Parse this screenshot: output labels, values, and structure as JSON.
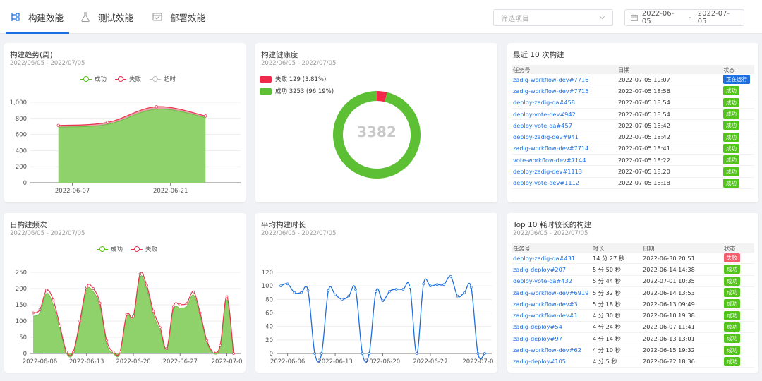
{
  "header": {
    "tabs": [
      {
        "label": "构建效能",
        "icon": "pipeline-icon",
        "active": true
      },
      {
        "label": "测试效能",
        "icon": "flask-icon",
        "active": false
      },
      {
        "label": "部署效能",
        "icon": "deploy-icon",
        "active": false
      }
    ],
    "project_select": {
      "placeholder": "筛选项目"
    },
    "date_range": {
      "start": "2022-06-05",
      "separator": "-",
      "end": "2022-07-05"
    }
  },
  "colors": {
    "accent": "#1b6fe0",
    "success": "#52c41a",
    "success_fill": "#8fd16a",
    "fail": "#e8344e",
    "timeout": "#c0c0c0",
    "running": "#1b6fe0"
  },
  "trend_card": {
    "title": "构建趋势(周)",
    "subtitle": "2022/06/05 - 2022/07/05",
    "legend": [
      {
        "name": "成功",
        "color": "#52c41a"
      },
      {
        "name": "失败",
        "color": "#e8344e"
      },
      {
        "name": "超时",
        "color": "#c0c0c0"
      }
    ]
  },
  "health_card": {
    "title": "构建健康度",
    "subtitle": "2022/06/05 - 2022/07/05",
    "legend": [
      {
        "label": "失败 129 (3.81%)",
        "color": "#f0284a"
      },
      {
        "label": "成功 3253 (96.19%)",
        "color": "#5cbf34"
      }
    ],
    "total": "3382"
  },
  "recent_card": {
    "title": "最近 10 次构建",
    "columns": [
      "任务号",
      "日期",
      "状态"
    ],
    "rows": [
      {
        "task": "zadig-workflow-dev#7716",
        "date": "2022-07-05 19:07",
        "status": "正在运行",
        "status_color": "#1b6fe0"
      },
      {
        "task": "zadig-workflow-dev#7715",
        "date": "2022-07-05 18:56",
        "status": "成功",
        "status_color": "#52c41a"
      },
      {
        "task": "deploy-zadig-qa#458",
        "date": "2022-07-05 18:54",
        "status": "成功",
        "status_color": "#52c41a"
      },
      {
        "task": "deploy-vote-dev#942",
        "date": "2022-07-05 18:54",
        "status": "成功",
        "status_color": "#52c41a"
      },
      {
        "task": "deploy-vote-qa#457",
        "date": "2022-07-05 18:42",
        "status": "成功",
        "status_color": "#52c41a"
      },
      {
        "task": "deploy-zadig-dev#941",
        "date": "2022-07-05 18:42",
        "status": "成功",
        "status_color": "#52c41a"
      },
      {
        "task": "zadig-workflow-dev#7714",
        "date": "2022-07-05 18:41",
        "status": "成功",
        "status_color": "#52c41a"
      },
      {
        "task": "vote-workflow-dev#7144",
        "date": "2022-07-05 18:22",
        "status": "成功",
        "status_color": "#52c41a"
      },
      {
        "task": "deploy-zadig-dev#1113",
        "date": "2022-07-05 18:20",
        "status": "成功",
        "status_color": "#52c41a"
      },
      {
        "task": "deploy-vote-dev#1112",
        "date": "2022-07-05 18:18",
        "status": "成功",
        "status_color": "#52c41a"
      }
    ]
  },
  "daily_card": {
    "title": "日构建频次",
    "subtitle": "2022/06/05 - 2022/07/05",
    "legend": [
      {
        "name": "成功",
        "color": "#52c41a"
      },
      {
        "name": "失败",
        "color": "#e8344e"
      }
    ]
  },
  "duration_card": {
    "title": "平均构建时长",
    "subtitle": "2022/06/05 - 2022/07/05"
  },
  "top10_card": {
    "title": "Top 10 耗时较长的构建",
    "subtitle": "2022/06/05 - 2022/07/05",
    "columns": [
      "任务号",
      "时长",
      "日期",
      "状态"
    ],
    "rows": [
      {
        "task": "deploy-zadig-qa#431",
        "duration": "14 分 27 秒",
        "date": "2022-06-30 20:51",
        "status": "失败",
        "status_color": "#f0606e"
      },
      {
        "task": "zadig-deploy#207",
        "duration": "5 分 50 秒",
        "date": "2022-06-14 14:38",
        "status": "成功",
        "status_color": "#52c41a"
      },
      {
        "task": "deploy-vote-qa#432",
        "duration": "5 分 44 秒",
        "date": "2022-07-01 10:35",
        "status": "成功",
        "status_color": "#52c41a"
      },
      {
        "task": "zadig-workflow-dev#6919",
        "duration": "5 分 32 秒",
        "date": "2022-06-14 13:53",
        "status": "成功",
        "status_color": "#52c41a"
      },
      {
        "task": "zadig-workflow-dev#3",
        "duration": "5 分 18 秒",
        "date": "2022-06-13 09:49",
        "status": "成功",
        "status_color": "#52c41a"
      },
      {
        "task": "zadig-workflow-dev#1",
        "duration": "4 分 30 秒",
        "date": "2022-06-10 19:38",
        "status": "成功",
        "status_color": "#52c41a"
      },
      {
        "task": "zadig-deploy#54",
        "duration": "4 分 24 秒",
        "date": "2022-06-07 11:41",
        "status": "成功",
        "status_color": "#52c41a"
      },
      {
        "task": "zadig-deploy#97",
        "duration": "4 分 14 秒",
        "date": "2022-06-13 13:01",
        "status": "成功",
        "status_color": "#52c41a"
      },
      {
        "task": "zadig-workflow-dev#62",
        "duration": "4 分 10 秒",
        "date": "2022-06-15 19:32",
        "status": "成功",
        "status_color": "#52c41a"
      },
      {
        "task": "zadig-deploy#105",
        "duration": "4 分 5 秒",
        "date": "2022-06-22 18:36",
        "status": "成功",
        "status_color": "#52c41a"
      }
    ]
  },
  "chart_data": [
    {
      "id": "trend",
      "type": "area",
      "x": [
        "2022-06-05",
        "2022-06-12",
        "2022-06-19",
        "2022-06-26"
      ],
      "series": [
        {
          "name": "成功",
          "values": [
            690,
            725,
            915,
            810
          ]
        },
        {
          "name": "失败",
          "values": [
            22,
            25,
            30,
            20
          ]
        },
        {
          "name": "超时",
          "values": [
            0,
            0,
            0,
            0
          ]
        }
      ],
      "xticks": [
        "2022-06-07",
        "2022-06-21"
      ],
      "yticks": [
        "0",
        "200",
        "400",
        "600",
        "800",
        "1,000"
      ],
      "ylim": [
        0,
        1000
      ],
      "xlim": [
        "2022-06-01",
        "2022-07-01"
      ]
    },
    {
      "id": "health",
      "type": "pie",
      "labels": [
        "失败",
        "成功"
      ],
      "values": [
        129,
        3253
      ],
      "total": 3382
    },
    {
      "id": "daily",
      "type": "area",
      "x": [
        "06-05",
        "06-06",
        "06-07",
        "06-08",
        "06-09",
        "06-10",
        "06-11",
        "06-12",
        "06-13",
        "06-14",
        "06-15",
        "06-16",
        "06-17",
        "06-18",
        "06-19",
        "06-20",
        "06-21",
        "06-22",
        "06-23",
        "06-24",
        "06-25",
        "06-26",
        "06-27",
        "06-28",
        "06-29",
        "06-30",
        "07-01",
        "07-02",
        "07-03",
        "07-04",
        "07-05"
      ],
      "series": [
        {
          "name": "成功",
          "values": [
            115,
            125,
            185,
            150,
            75,
            0,
            0,
            90,
            195,
            190,
            145,
            30,
            0,
            0,
            115,
            110,
            235,
            200,
            120,
            70,
            10,
            135,
            140,
            145,
            180,
            115,
            35,
            0,
            20,
            165,
            0
          ]
        },
        {
          "name": "失败",
          "values": [
            125,
            135,
            195,
            165,
            85,
            5,
            5,
            100,
            205,
            200,
            155,
            40,
            5,
            5,
            120,
            115,
            245,
            210,
            130,
            80,
            15,
            145,
            150,
            155,
            190,
            125,
            40,
            5,
            25,
            175,
            0
          ]
        }
      ],
      "xticks": [
        "2022-06-06",
        "2022-06-13",
        "2022-06-20",
        "2022-06-27",
        "2022-07-0"
      ],
      "yticks": [
        "0",
        "50",
        "100",
        "150",
        "200",
        "250"
      ],
      "ylim": [
        0,
        250
      ]
    },
    {
      "id": "duration",
      "type": "line",
      "x": [
        "06-05",
        "06-06",
        "06-07",
        "06-08",
        "06-09",
        "06-10",
        "06-11",
        "06-12",
        "06-13",
        "06-14",
        "06-15",
        "06-16",
        "06-17",
        "06-18",
        "06-19",
        "06-20",
        "06-21",
        "06-22",
        "06-23",
        "06-24",
        "06-25",
        "06-26",
        "06-27",
        "06-28",
        "06-29",
        "06-30",
        "07-01",
        "07-02",
        "07-03",
        "07-04",
        "07-05"
      ],
      "series": [
        {
          "name": "平均构建时长",
          "values": [
            100,
            103,
            90,
            90,
            93,
            0,
            0,
            93,
            87,
            80,
            85,
            95,
            0,
            0,
            92,
            78,
            92,
            95,
            95,
            98,
            0,
            103,
            100,
            102,
            102,
            114,
            85,
            90,
            98,
            0,
            0
          ]
        }
      ],
      "xticks": [
        "2022-06-06",
        "2022-06-13",
        "2022-06-20",
        "2022-06-27",
        "2022-07-0"
      ],
      "yticks": [
        "0",
        "20",
        "40",
        "60",
        "80",
        "100",
        "120"
      ],
      "ylim": [
        0,
        120
      ]
    }
  ]
}
